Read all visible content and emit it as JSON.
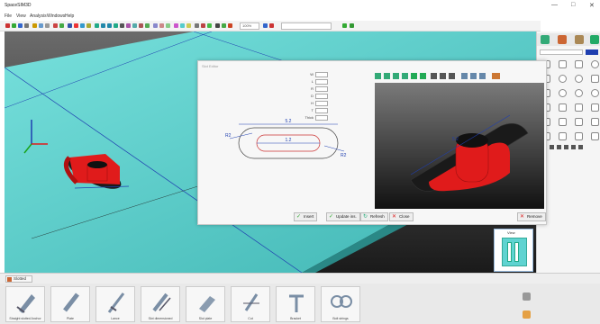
{
  "window": {
    "title": "SpaceSIM3D",
    "controls": {
      "minimize": "—",
      "maximize": "□",
      "close": "✕"
    }
  },
  "menu": [
    "File",
    "View",
    "Analysis",
    "Windows",
    "Help"
  ],
  "toolbar": {
    "combo1": "100%",
    "combo2": ""
  },
  "dialog": {
    "title": "Slot Editor",
    "params": [
      {
        "label": "W",
        "value": ""
      },
      {
        "label": "L",
        "value": ""
      },
      {
        "label": "R",
        "value": ""
      },
      {
        "label": "D",
        "value": ""
      },
      {
        "label": "H",
        "value": ""
      },
      {
        "label": "T",
        "value": ""
      },
      {
        "label": "Thick",
        "value": ""
      }
    ],
    "sketch_labels": {
      "top": "5.2",
      "mid": "1.2",
      "left": "R2",
      "right": "R2"
    },
    "preview_label": "5.2",
    "buttons": {
      "insert": "Insert",
      "update": "Update ins.",
      "redo": "Refresh",
      "close": "Close",
      "remove": "Remove"
    }
  },
  "library": {
    "header": "Slotted",
    "items": [
      {
        "label": "Straight slotted Anchor"
      },
      {
        "label": "Plate"
      },
      {
        "label": "Lance"
      },
      {
        "label": "Slot dimensioned"
      },
      {
        "label": "Slot plate"
      },
      {
        "label": "Cut"
      },
      {
        "label": "Bracket"
      },
      {
        "label": "Bolt strings"
      }
    ]
  },
  "minimap": {
    "title": "View"
  },
  "colors": {
    "floor": "#5fd3d1",
    "part_red": "#e01b1b",
    "accent_blue": "#1f3fb0"
  }
}
